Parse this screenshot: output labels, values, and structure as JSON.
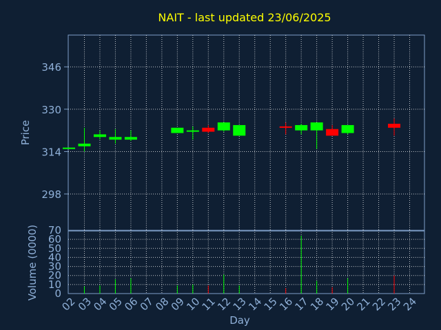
{
  "chart_data": [
    {
      "type": "candlestick",
      "title": "NAIT - last updated 23/06/2025",
      "ylabel": "Price",
      "ylim": [
        284,
        358
      ],
      "yticks": [
        298,
        314,
        330,
        346
      ],
      "grid": true,
      "colors": {
        "up": "#00ff00",
        "down": "#ff0000",
        "title": "#ffff00",
        "axis_text": "#8fb0d8",
        "grid": "#ffffff",
        "frame": "#7f9fc8"
      },
      "days": [
        "02",
        "03",
        "04",
        "05",
        "06",
        "07",
        "08",
        "09",
        "10",
        "11",
        "12",
        "13",
        "14",
        "15",
        "16",
        "17",
        "18",
        "19",
        "20",
        "21",
        "22",
        "23",
        "24"
      ],
      "candles": [
        {
          "day": "02",
          "open": 315.0,
          "close": 315.5,
          "high": 315.5,
          "low": 315.0
        },
        {
          "day": "03",
          "open": 316.0,
          "close": 317.0,
          "high": 323.0,
          "low": 314.0
        },
        {
          "day": "04",
          "open": 319.5,
          "close": 320.5,
          "high": 322.0,
          "low": 318.5
        },
        {
          "day": "05",
          "open": 318.5,
          "close": 319.5,
          "high": 322.5,
          "low": 317.0
        },
        {
          "day": "06",
          "open": 318.5,
          "close": 319.5,
          "high": 322.0,
          "low": 318.0
        },
        {
          "day": "09",
          "open": 321.0,
          "close": 323.0,
          "high": 323.0,
          "low": 321.0
        },
        {
          "day": "10",
          "open": 321.5,
          "close": 322.0,
          "high": 323.5,
          "low": 318.5
        },
        {
          "day": "11",
          "open": 323.0,
          "close": 321.5,
          "high": 324.0,
          "low": 321.0
        },
        {
          "day": "12",
          "open": 322.0,
          "close": 325.0,
          "high": 325.0,
          "low": 321.5
        },
        {
          "day": "13",
          "open": 320.0,
          "close": 324.0,
          "high": 324.0,
          "low": 320.0
        },
        {
          "day": "16",
          "open": 323.5,
          "close": 323.0,
          "high": 325.0,
          "low": 320.5
        },
        {
          "day": "17",
          "open": 322.0,
          "close": 324.0,
          "high": 324.5,
          "low": 320.5
        },
        {
          "day": "18",
          "open": 322.0,
          "close": 325.0,
          "high": 325.0,
          "low": 315.0
        },
        {
          "day": "19",
          "open": 322.5,
          "close": 320.0,
          "high": 324.0,
          "low": 320.0
        },
        {
          "day": "20",
          "open": 321.0,
          "close": 324.0,
          "high": 324.0,
          "low": 320.5
        },
        {
          "day": "23",
          "open": 324.5,
          "close": 323.0,
          "high": 326.5,
          "low": 320.0
        }
      ]
    },
    {
      "type": "bar",
      "ylabel": "Volume (0000)",
      "xlabel": "Day",
      "ylim": [
        0,
        70
      ],
      "yticks": [
        0,
        10,
        20,
        30,
        40,
        50,
        60,
        70
      ],
      "grid": true,
      "days": [
        "02",
        "03",
        "04",
        "05",
        "06",
        "07",
        "08",
        "09",
        "10",
        "11",
        "12",
        "13",
        "14",
        "15",
        "16",
        "17",
        "18",
        "19",
        "20",
        "21",
        "22",
        "23",
        "24"
      ],
      "bars": [
        {
          "day": "03",
          "value": 8,
          "direction": "up"
        },
        {
          "day": "04",
          "value": 9,
          "direction": "up"
        },
        {
          "day": "05",
          "value": 16,
          "direction": "up"
        },
        {
          "day": "06",
          "value": 17,
          "direction": "up"
        },
        {
          "day": "09",
          "value": 9,
          "direction": "up"
        },
        {
          "day": "10",
          "value": 10,
          "direction": "up"
        },
        {
          "day": "11",
          "value": 9,
          "direction": "down"
        },
        {
          "day": "12",
          "value": 21,
          "direction": "up"
        },
        {
          "day": "13",
          "value": 9,
          "direction": "up"
        },
        {
          "day": "16",
          "value": 6,
          "direction": "down"
        },
        {
          "day": "17",
          "value": 64,
          "direction": "up"
        },
        {
          "day": "18",
          "value": 14,
          "direction": "up"
        },
        {
          "day": "19",
          "value": 7,
          "direction": "down"
        },
        {
          "day": "20",
          "value": 17,
          "direction": "up"
        },
        {
          "day": "23",
          "value": 20,
          "direction": "down"
        }
      ]
    }
  ]
}
